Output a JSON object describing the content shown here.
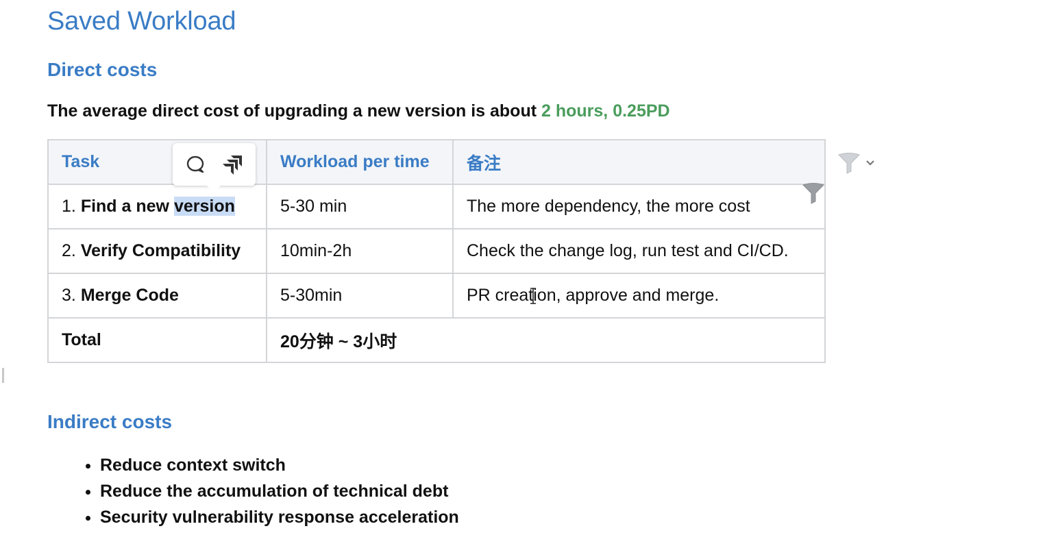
{
  "page": {
    "title": "Saved Workload"
  },
  "direct": {
    "heading": "Direct costs",
    "summary_prefix": "The average direct cost of upgrading a new version is about",
    "summary_highlight": "2 hours, 0.25PD"
  },
  "table": {
    "headers": [
      "Task",
      "Workload per time",
      "备注"
    ],
    "rows": [
      {
        "num": "1.",
        "task_pre": "Find a new",
        "task_selected": "version",
        "workload": "5-30 min",
        "note": "The more dependency, the more cost"
      },
      {
        "num": "2.",
        "task": "Verify Compatibility",
        "workload": "10min-2h",
        "note": "Check the change log, run test and CI/CD."
      },
      {
        "num": "3.",
        "task": "Merge Code",
        "workload": "5-30min",
        "note": "PR creation, approve and merge."
      }
    ],
    "total": {
      "label": "Total",
      "value": "20分钟 ~ 3小时"
    }
  },
  "indirect": {
    "heading": "Indirect costs",
    "items": [
      "Reduce context switch",
      "Reduce the accumulation of technical debt",
      "Security vulnerability response acceleration"
    ]
  },
  "icons": {
    "comment": "comment-icon",
    "jira": "jira-icon",
    "filter": "filter-icon",
    "chevron": "chevron-down-icon"
  },
  "colors": {
    "heading": "#3a7cc5",
    "highlight": "#4a9d5c",
    "table_header_bg": "#f3f5f8",
    "selection": "#c9dcf5"
  }
}
